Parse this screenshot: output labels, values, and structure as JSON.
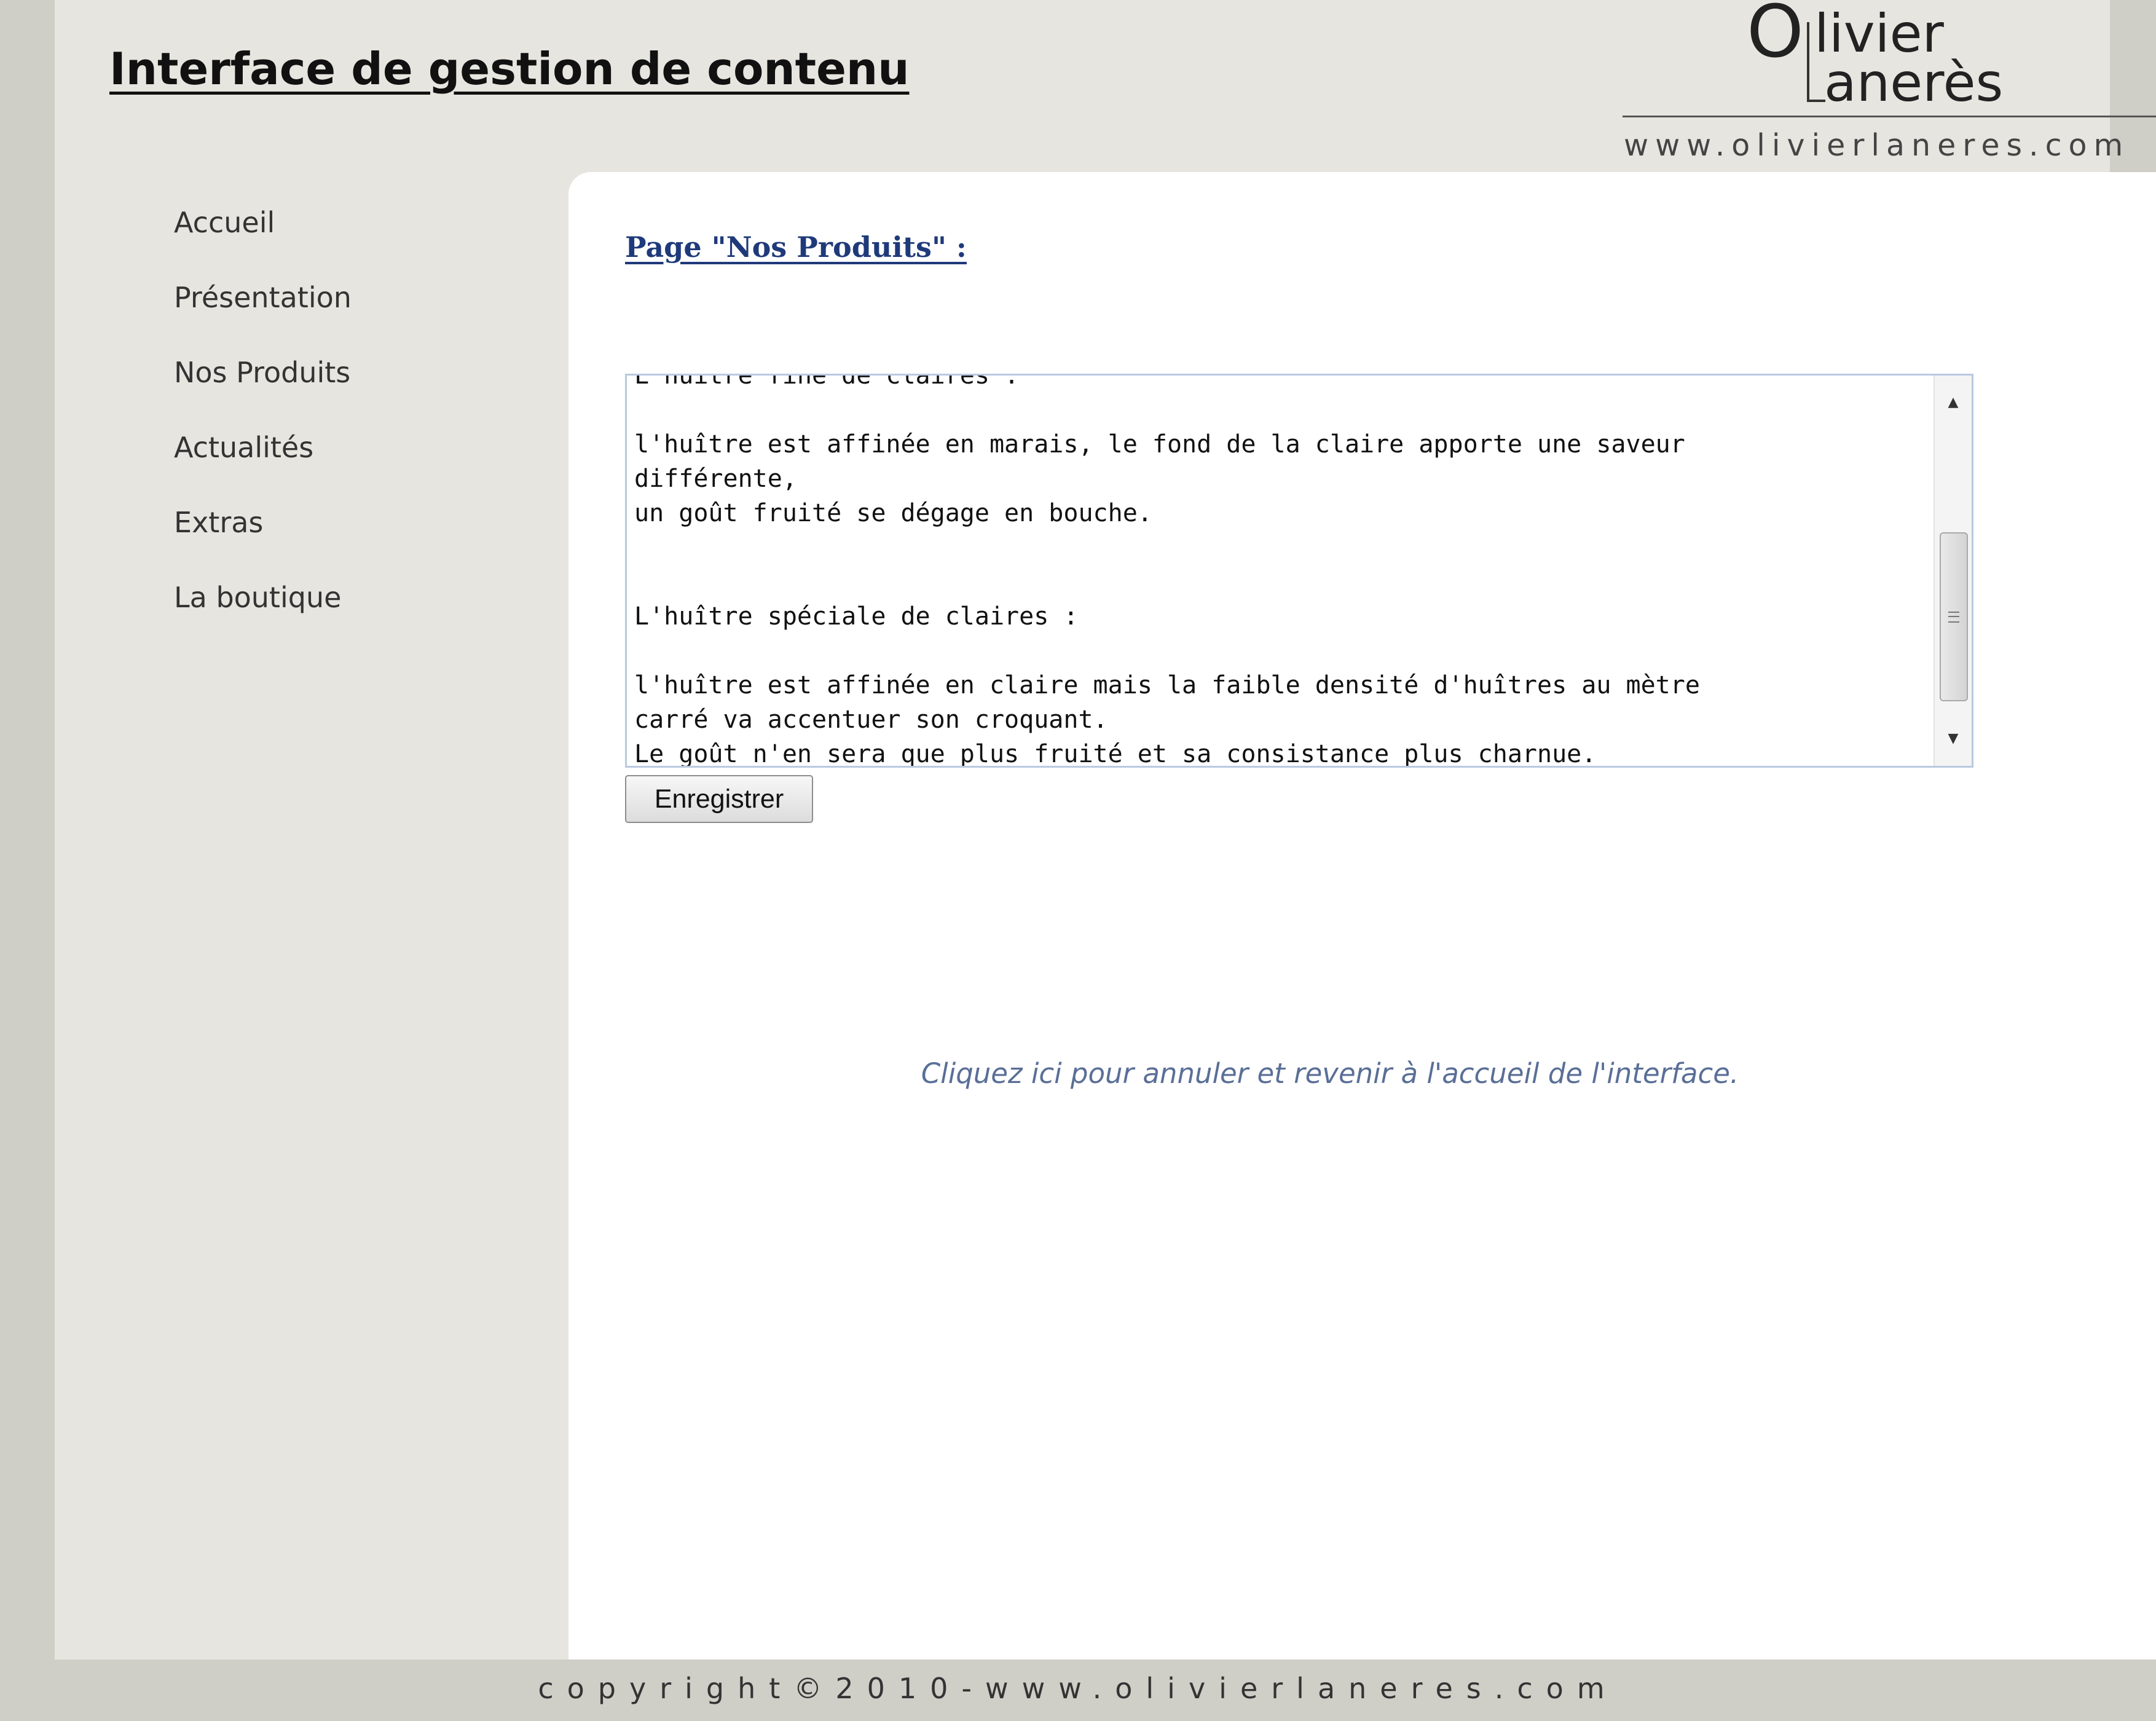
{
  "header": {
    "title": "Interface de gestion de contenu",
    "logo": {
      "first_letter": "O",
      "line1": "livier",
      "line2": "anerès",
      "url": "www.olivierlaneres.com"
    }
  },
  "sidebar": {
    "items": [
      {
        "label": "Accueil"
      },
      {
        "label": "Présentation"
      },
      {
        "label": "Nos Produits"
      },
      {
        "label": "Actualités"
      },
      {
        "label": "Extras"
      },
      {
        "label": "La boutique"
      }
    ]
  },
  "main": {
    "heading": "Page \"Nos Produits\" :",
    "editor": {
      "value": "L'huître fine de claires :\n\nl'huître est affinée en marais, le fond de la claire apporte une saveur\ndifférente,\nun goût fruité se dégage en bouche.\n\n\nL'huître spéciale de claires :\n\nl'huître est affinée en claire mais la faible densité d'huîtres au mètre\ncarré va accentuer son croquant.\nLe goût n'en sera que plus fruité et sa consistance plus charnue."
    },
    "save_label": "Enregistrer",
    "cancel_text": "Cliquez ici pour annuler et revenir à l'accueil de l'interface."
  },
  "footer": {
    "text": "copyright©2010-www.olivierlaneres.com"
  },
  "colors": {
    "background": "#cfcec7",
    "page": "#e6e5df",
    "content": "#ffffff",
    "heading_link": "#1f3a7a",
    "cancel_link": "#5a6f97"
  },
  "icons": {
    "scroll_up": "triangle-up",
    "scroll_down": "triangle-down",
    "scroll_grip": "grip-lines"
  }
}
